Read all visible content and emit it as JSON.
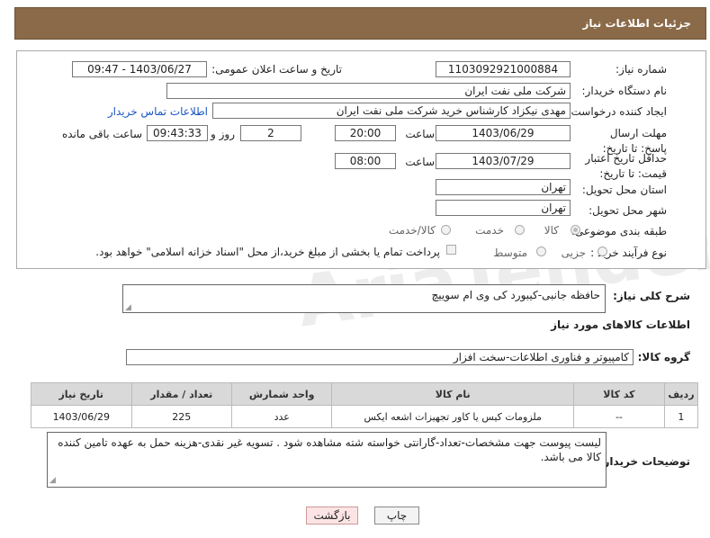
{
  "header": {
    "title": "جزئیات اطلاعات نیاز"
  },
  "fields": {
    "need_number": {
      "label": "شماره نیاز:",
      "value": "1103092921000884"
    },
    "announce_date": {
      "label": "تاریخ و ساعت اعلان عمومی:",
      "value": "1403/06/27 - 09:47"
    },
    "buyer_org": {
      "label": "نام دستگاه خریدار:",
      "value": "شرکت ملی نفت ایران"
    },
    "creator": {
      "label": "ایجاد کننده درخواست:",
      "value": "مهدی نیکزاد کارشناس خرید شرکت ملی نفت ایران",
      "contact_link": "اطلاعات تماس خریدار"
    },
    "response_deadline": {
      "label": "مهلت ارسال پاسخ: تا تاریخ:",
      "date": "1403/06/29",
      "time_label": "ساعت",
      "time": "20:00",
      "days": "2",
      "days_label": "روز و",
      "remaining": "09:43:33",
      "remaining_label": "ساعت باقی مانده"
    },
    "price_validity": {
      "label": "حداقل تاریخ اعتبار قیمت: تا تاریخ:",
      "date": "1403/07/29",
      "time_label": "ساعت",
      "time": "08:00"
    },
    "province": {
      "label": "استان محل تحویل:",
      "value": "تهران"
    },
    "city": {
      "label": "شهر محل تحویل:",
      "value": "تهران"
    },
    "category": {
      "label": "طبقه بندی موضوعی:",
      "options": [
        "کالا",
        "خدمت",
        "کالا/خدمت"
      ],
      "selected": "کالا"
    },
    "purchase_type": {
      "label": "نوع فرآیند خرید :",
      "options": [
        "جزیی",
        "متوسط"
      ],
      "note": "پرداخت تمام یا بخشی از مبلغ خرید،از محل \"اسناد خزانه اسلامی\" خواهد بود."
    }
  },
  "summary": {
    "label": "شرح کلی نیاز:",
    "value": "حافظه جانبی-کیبورد کی وی ام سوییچ"
  },
  "goods_section": {
    "title": "اطلاعات کالاهای مورد نیاز"
  },
  "goods_group": {
    "label": "گروه کالا:",
    "value": "کامپیوتر و فناوری اطلاعات-سخت افزار"
  },
  "table": {
    "headers": [
      "ردیف",
      "کد کالا",
      "نام کالا",
      "واحد شمارش",
      "تعداد / مقدار",
      "تاریخ نیاز"
    ],
    "rows": [
      [
        "1",
        "--",
        "ملزومات کیس یا کاور تجهیزات اشعه ایکس",
        "عدد",
        "225",
        "1403/06/29"
      ]
    ]
  },
  "buyer_notes": {
    "label": "توضیحات خریدار:",
    "value": "لیست پیوست جهت مشخصات-تعداد-گارانتی خواسته شته مشاهده شود . تسویه غیر نقدی-هزینه حمل به عهده تامین کننده کالا می باشد."
  },
  "buttons": {
    "print": "چاپ",
    "back": "بازگشت"
  },
  "watermark": "AriaTender.neT",
  "colors": {
    "header_bg": "#8a6a48",
    "back_button_bg": "#fde4e4",
    "print_button_bg": "#f3f3f3"
  }
}
